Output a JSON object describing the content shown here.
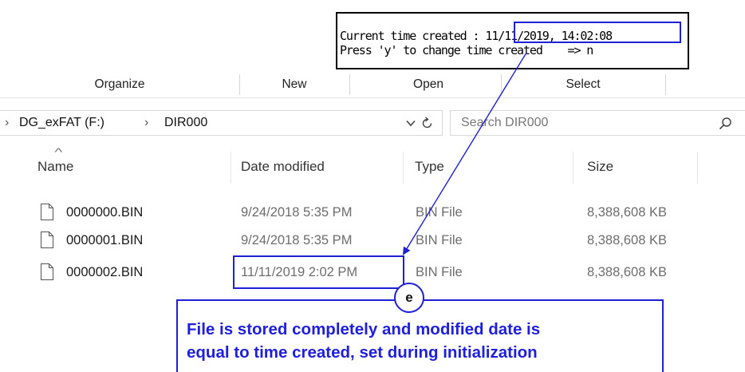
{
  "console": {
    "line1_label": "Current time created : ",
    "line1_value": "11/11/2019, 14:02:08",
    "line2": "Press 'y' to change time created    => n"
  },
  "ribbon": {
    "groups": [
      "Organize",
      "New",
      "Open",
      "Select"
    ]
  },
  "address": {
    "chevron": "›",
    "drive": "DG_exFAT (F:)",
    "folder": "DIR000",
    "dropdown_icon": "chevron-down-icon",
    "refresh_icon": "refresh-icon",
    "search_placeholder": "Search DIR000",
    "search_icon": "search-icon"
  },
  "columns": {
    "name": "Name",
    "date": "Date modified",
    "type": "Type",
    "size": "Size",
    "sort_indicator": "^"
  },
  "files": [
    {
      "name": "0000000.BIN",
      "date": "9/24/2018 5:35 PM",
      "type": "BIN File",
      "size": "8,388,608 KB"
    },
    {
      "name": "0000001.BIN",
      "date": "9/24/2018 5:35 PM",
      "type": "BIN File",
      "size": "8,388,608 KB"
    },
    {
      "name": "0000002.BIN",
      "date": "11/11/2019 2:02 PM",
      "type": "BIN File",
      "size": "8,388,608 KB"
    }
  ],
  "annotation": {
    "marker": "e",
    "line1": "File is stored completely and modified date is",
    "line2": "equal to time created, set during initialization",
    "color": "#1f1fd6"
  }
}
